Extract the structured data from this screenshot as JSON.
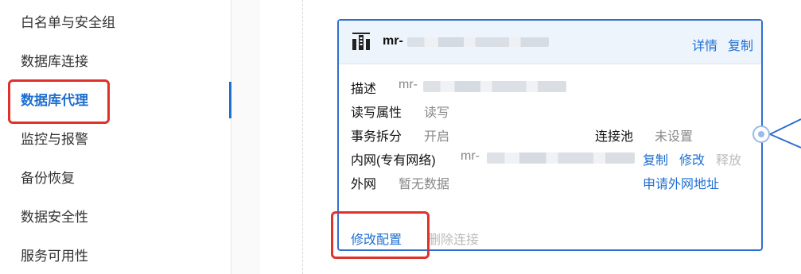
{
  "sidebar": {
    "items": [
      {
        "label": "白名单与安全组"
      },
      {
        "label": "数据库连接"
      },
      {
        "label": "数据库代理"
      },
      {
        "label": "监控与报警"
      },
      {
        "label": "备份恢复"
      },
      {
        "label": "数据安全性"
      },
      {
        "label": "服务可用性"
      }
    ],
    "active_index": 2
  },
  "proxy_card": {
    "icon": "database-icon",
    "title_prefix": "mr-",
    "actions": {
      "detail": "详情",
      "copy": "复制"
    },
    "rows": {
      "description": {
        "label": "描述",
        "value_prefix": "mr-"
      },
      "rw_attr": {
        "label": "读写属性",
        "value": "读写"
      },
      "tx_split": {
        "label": "事务拆分",
        "value": "开启"
      },
      "conn_pool": {
        "label": "连接池",
        "value": "未设置"
      },
      "private_net": {
        "label": "内网(专有网络)",
        "value_prefix": "mr-",
        "copy": "复制",
        "modify": "修改",
        "release": "释放"
      },
      "public_net": {
        "label": "外网",
        "value": "暂无数据",
        "apply": "申请外网地址"
      }
    },
    "footer": {
      "modify_config": "修改配置",
      "delete_conn": "删除连接"
    }
  },
  "colors": {
    "accent": "#1f6fd1",
    "highlight": "#e0312a",
    "card_border": "#2f6fd0"
  }
}
